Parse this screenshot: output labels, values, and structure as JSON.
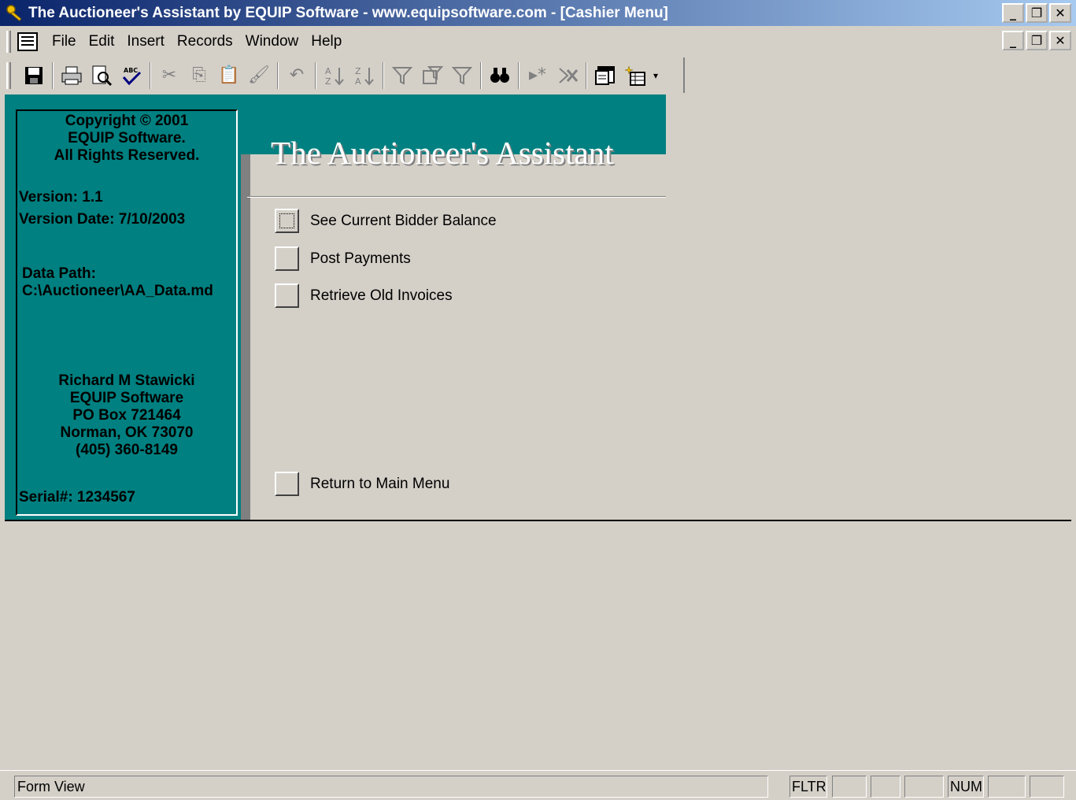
{
  "window": {
    "title": "The Auctioneer's Assistant by EQUIP Software - www.equipsoftware.com - [Cashier Menu]",
    "controls": {
      "minimize": "_",
      "restore": "❐",
      "close": "✕"
    }
  },
  "menubar": {
    "items": [
      "File",
      "Edit",
      "Insert",
      "Records",
      "Window",
      "Help"
    ]
  },
  "toolbar": {
    "buttons": [
      "save-icon",
      "print-icon",
      "print-preview-icon",
      "spelling-icon",
      "cut-icon",
      "copy-icon",
      "paste-icon",
      "format-painter-icon",
      "undo-icon",
      "sort-ascending-icon",
      "sort-descending-icon",
      "filter-by-selection-icon",
      "filter-by-form-icon",
      "apply-filter-icon",
      "find-icon",
      "new-record-icon",
      "delete-record-icon",
      "database-window-icon",
      "new-object-icon"
    ]
  },
  "info": {
    "copyright_line1": "Copyright © 2001",
    "copyright_line2": "EQUIP Software.",
    "copyright_line3": "All Rights Reserved.",
    "version": "Version: 1.1",
    "version_date": "Version Date:  7/10/2003",
    "data_path_label": "Data Path:",
    "data_path": "C:\\Auctioneer\\AA_Data.md",
    "contact_name": "Richard M Stawicki",
    "contact_company": "EQUIP Software",
    "contact_po": "PO Box 721464",
    "contact_city": "Norman, OK 73070",
    "contact_phone": "(405) 360-8149",
    "serial": "Serial#: 1234567"
  },
  "form": {
    "app_title": "The Auctioneer's Assistant",
    "options": [
      {
        "label": "See Current Bidder Balance"
      },
      {
        "label": "Post Payments"
      },
      {
        "label": "Retrieve Old Invoices"
      }
    ],
    "return_label": "Return to Main Menu"
  },
  "status": {
    "mode": "Form View",
    "fltr": "FLTR",
    "num": "NUM"
  }
}
